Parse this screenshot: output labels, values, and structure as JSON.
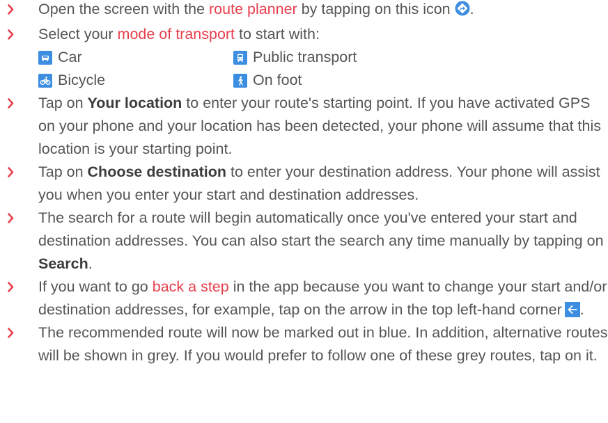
{
  "colors": {
    "accent": "#e8404d",
    "icon_blue": "#3d8ee0",
    "bullet": "#e8404d",
    "text": "#555555"
  },
  "items": [
    {
      "t1": "Open the screen with the ",
      "link": "route planner",
      "t2": " by tapping on this icon",
      "t3": ".",
      "icon": "directions-icon"
    },
    {
      "t1": "Select your ",
      "link": "mode of transport",
      "t2": " to start with:",
      "modes": [
        {
          "label": "Car",
          "icon": "car-icon"
        },
        {
          "label": "Public transport",
          "icon": "bus-icon"
        },
        {
          "label": "Bicycle",
          "icon": "bicycle-icon"
        },
        {
          "label": "On foot",
          "icon": "walking-icon"
        }
      ]
    },
    {
      "t1": "Tap on ",
      "bold": "Your location",
      "t2": " to enter your route's starting point. If you have activated GPS on your phone and your location has been detected, your phone will assume that this location is your starting point."
    },
    {
      "t1": "Tap on ",
      "bold": "Choose destination",
      "t2": " to enter your destination address. Your phone will assist you when you enter your start and destination addresses."
    },
    {
      "t1": "The search for a route will begin automatically once you've entered your start and destination addresses. You can also start the search any time manually by tapping on ",
      "bold": "Search",
      "t2": "."
    },
    {
      "t1": "If you want to go ",
      "link": "back a step",
      "t2": " in the app because you want to change your start and/or destination addresses, for example, tap on the arrow in the top left-hand corner",
      "t3": ".",
      "icon": "back-arrow-icon"
    },
    {
      "t1": "The recommended route will now be marked out in blue. In addition, alternative routes will be shown in grey. If you would prefer to follow one of these grey routes, tap on it."
    }
  ]
}
